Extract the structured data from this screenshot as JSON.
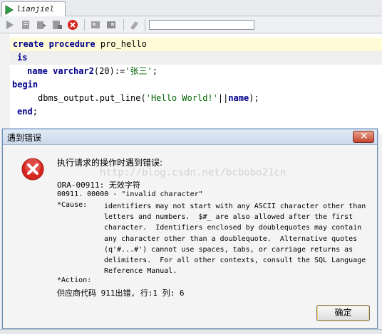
{
  "editor": {
    "tab_label": "lianjiel",
    "code": {
      "l1_kw": "create procedure",
      "l1_name": " pro_hello",
      "l2_kw": "is",
      "l3_name": "name ",
      "l3_type": "varchar2",
      "l3_open": "(",
      "l3_num": "20",
      "l3_close": "):=",
      "l3_str": "'张三'",
      "l3_end": ";",
      "l4_kw": "begin",
      "l5_call": "dbms_output.put_line(",
      "l5_str": "'Hello World!'",
      "l5_op": "||",
      "l5_var": "name",
      "l5_end": ");",
      "l6_kw": "end",
      "l6_end": ";"
    }
  },
  "dialog": {
    "title": "遇到错误",
    "close_glyph": "✕",
    "header": "执行请求的操作时遇到错误:",
    "code_line1": "ORA-00911: 无效字符",
    "code_line2": "00911. 00000 -  \"invalid character\"",
    "cause_label": "*Cause:",
    "cause_text": "identifiers may not start with any ASCII character other than\nletters and numbers.  $#_ are also allowed after the first\ncharacter.  Identifiers enclosed by doublequotes may contain\nany character other than a doublequote.  Alternative quotes\n(q'#...#') cannot use spaces, tabs, or carriage returns as\ndelimiters.  For all other contexts, consult the SQL Language\nReference Manual.",
    "action_label": "*Action:",
    "vendor_line": "供应商代码 911出错, 行:1 列: 6",
    "watermark": "http://blog.csdn.net/bcbobo21cn",
    "ok_label": "确定"
  },
  "icons": {
    "tab": "run-icon",
    "error": "error-icon"
  },
  "colors": {
    "keyword": "#00008b",
    "string": "#006400",
    "error_red": "#d8251d"
  }
}
